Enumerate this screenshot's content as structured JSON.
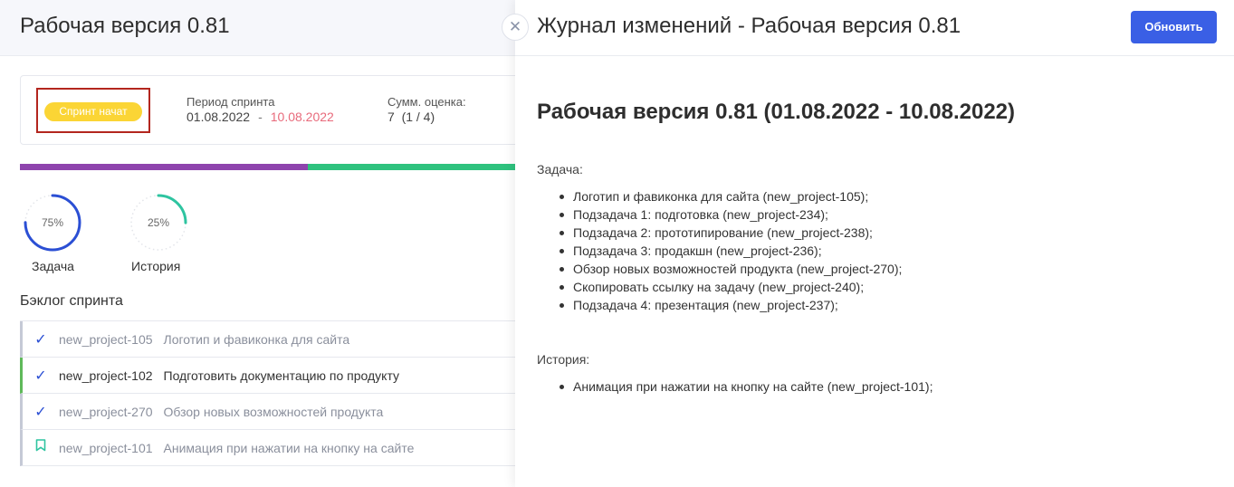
{
  "page": {
    "title": "Рабочая версия 0.81"
  },
  "summary": {
    "status_badge": "Спринт начат",
    "period_label": "Период спринта",
    "period_start": "01.08.2022",
    "period_separator": "-",
    "period_end": "10.08.2022",
    "estimate_label": "Сумм. оценка:",
    "estimate_value": "7  (1 / 4)"
  },
  "progress": {
    "first_segment_fraction": 0.568,
    "first_color": "#8e44ad",
    "second_color": "#2ec27e"
  },
  "stats": [
    {
      "percent": 75,
      "percent_label": "75%",
      "caption": "Задача",
      "color": "#2b4fd4"
    },
    {
      "percent": 25,
      "percent_label": "25%",
      "caption": "История",
      "color": "#2ec4a0"
    }
  ],
  "backlog": {
    "title": "Бэклог спринта",
    "items": [
      {
        "key": "new_project-105",
        "name": "Логотип и фавиконка для сайта",
        "icon": "check-icon"
      },
      {
        "key": "new_project-102",
        "name": "Подготовить документацию по продукту",
        "icon": "check-icon"
      },
      {
        "key": "new_project-270",
        "name": "Обзор новых возможностей продукта",
        "icon": "check-icon"
      },
      {
        "key": "new_project-101",
        "name": "Анимация при нажатии на кнопку на сайте",
        "icon": "bookmark-icon"
      }
    ]
  },
  "changelog": {
    "title": "Журнал изменений - Рабочая версия 0.81",
    "refresh_label": "Обновить",
    "close_icon": "close-icon",
    "release_heading": "Рабочая версия 0.81 (01.08.2022 - 10.08.2022)",
    "tasks_label": "Задача:",
    "tasks": [
      "Логотип и фавиконка для сайта (new_project-105);",
      "Подзадача 1: подготовка (new_project-234);",
      "Подзадача 2: прототипирование (new_project-238);",
      "Подзадача 3: продакшн (new_project-236);",
      "Обзор новых возможностей продукта (new_project-270);",
      "Скопировать ссылку на задачу (new_project-240);",
      "Подзадача 4: презентация (new_project-237);"
    ],
    "stories_label": "История:",
    "stories": [
      "Анимация при нажатии на кнопку на сайте (new_project-101);"
    ]
  }
}
